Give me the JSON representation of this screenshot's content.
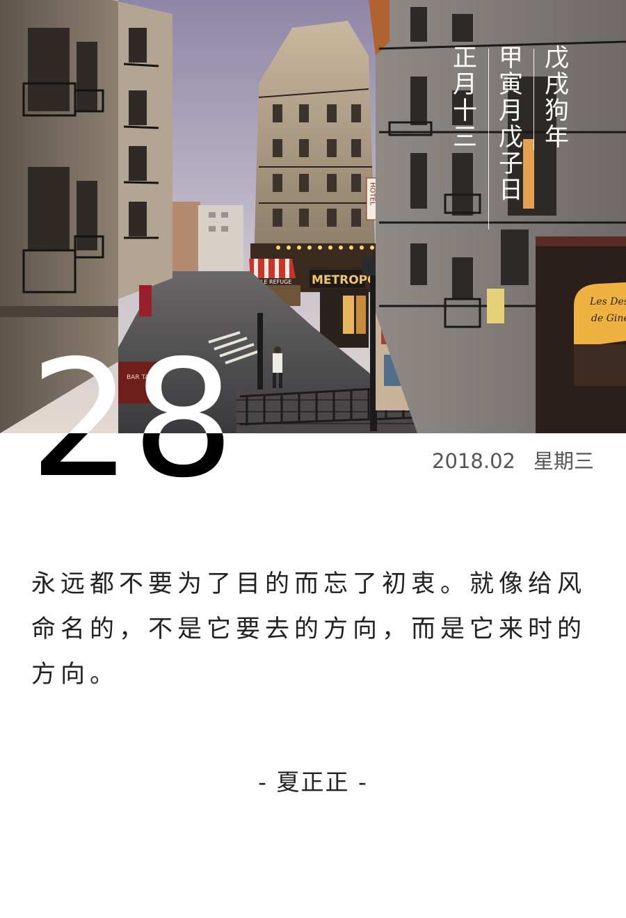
{
  "lunar": {
    "year": "戊戌狗年",
    "month_day": "甲寅月戊子日",
    "date": "正月十三"
  },
  "calendar": {
    "day": "28",
    "year_month": "2018.02",
    "weekday": "星期三"
  },
  "photo_signs": {
    "hotel": "HOTEL",
    "metropol": "METROPOLE",
    "le_refuge": "LE REFUGE",
    "les_desserts": "Les Des",
    "de_gine": "de Giné",
    "bar_tabac": "BAR TABA"
  },
  "quote": {
    "text": "永远都不要为了目的而忘了初衷。就像给风命名的，不是它要去的方向，而是它来时的方向。",
    "author": "- 夏正正 -"
  }
}
